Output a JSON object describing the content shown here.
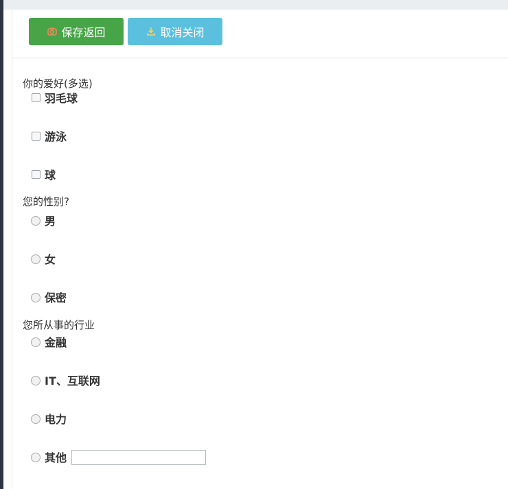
{
  "toolbar": {
    "save_label": "保存返回",
    "cancel_label": "取消关闭"
  },
  "questions": [
    {
      "title": "你的爱好(多选)",
      "type": "checkbox",
      "options": [
        "羽毛球",
        "游泳",
        "球"
      ]
    },
    {
      "title": "您的性别?",
      "type": "radio",
      "options": [
        "男",
        "女",
        "保密"
      ]
    },
    {
      "title": "您所从事的行业",
      "type": "radio",
      "options": [
        "金融",
        "IT、互联网",
        "电力",
        "其他"
      ]
    }
  ],
  "colors": {
    "save_button": "#47a447",
    "cancel_button": "#5bc0de",
    "left_rail": "#2f3542"
  },
  "icons": {
    "save": "save-icon",
    "cancel": "download-icon"
  }
}
